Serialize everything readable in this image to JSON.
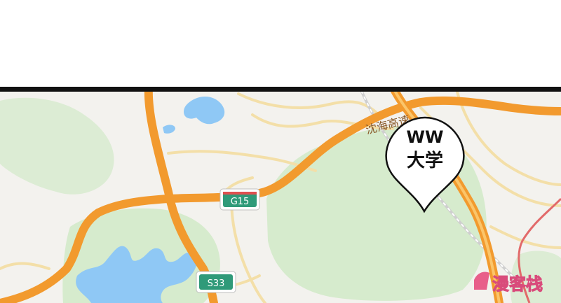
{
  "map": {
    "expressway_label": "沈海高速",
    "shields": [
      {
        "label": "G15"
      },
      {
        "label": "S33"
      }
    ],
    "marker": {
      "line1": "WW",
      "line2": "大学"
    },
    "colors": {
      "land": "#f3f2ee",
      "park": "#d8ecd0",
      "water": "#8fc8f5",
      "major_road": "#f29a2e",
      "minor_road": "#f3dfa8",
      "rail": "#cfcfcf",
      "border_line": "#111111",
      "shield_green": "#2f9a79"
    }
  },
  "watermark": {
    "text": "漫客栈",
    "icon": "comic-logo-icon"
  }
}
